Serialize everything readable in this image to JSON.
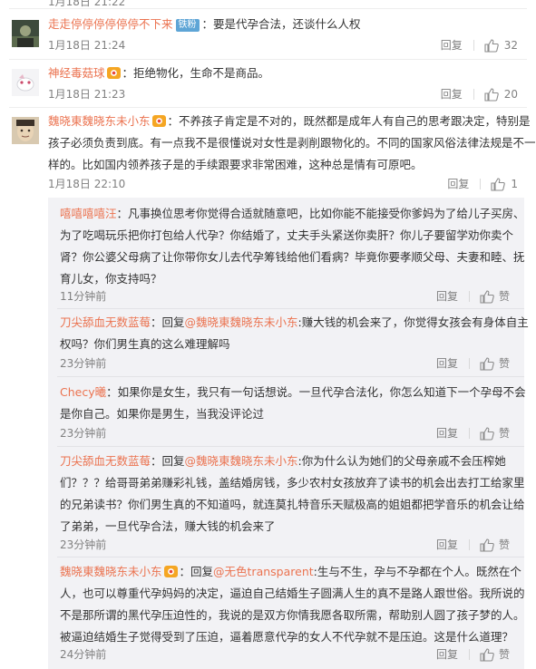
{
  "top_partial": {
    "time": "1月18日 21:22",
    "likes": ""
  },
  "comments": [
    {
      "id": "c1",
      "username": "走走停停停停停停不下来",
      "badge": "铁粉",
      "text": "：要是代孕合法，还谈什么人权",
      "time": "1月18日 21:24",
      "reply_label": "回复",
      "likes": "32"
    },
    {
      "id": "c2",
      "username": "神经毒菇球",
      "text": "：拒绝物化，生命不是商品。",
      "time": "1月18日 21:23",
      "reply_label": "回复",
      "likes": "20"
    },
    {
      "id": "c3",
      "username": "魏晓東魏晓东未小东",
      "lines": [
        "：不养孩子肯定是不对的，既然都是成年人有自己的思考跟决定，特别是",
        "孩子必须负责到底。有一点我不是很懂说对女性是剥削跟物化的。不同的国家风俗法律法规是不一",
        "样的。比如国内领养孩子是的手续跟要求非常困难，这种总是情有可原吧。"
      ],
      "time": "1月18日 22:10",
      "reply_label": "回复",
      "likes": "1"
    }
  ],
  "replies": [
    {
      "username": "嘻嘻嘻嘻汪",
      "lines": [
        "：凡事换位思考你觉得合适就随意吧，比如你能不能接受你爹妈为了给儿子买房、",
        "为了吃喝玩乐把你打包给人代孕？你结婚了，丈夫手头紧送你卖肝？你儿子要留学劝你卖个",
        "肾？你公婆父母病了让你带你女儿去代孕筹钱给他们看病？毕竟你要孝顺父母、夫妻和睦、抚",
        "育儿女，你支持吗？"
      ],
      "time": "11分钟前",
      "reply_label": "回复",
      "like_label": "赞"
    },
    {
      "username": "刀尖舔血无数蓝莓",
      "reply_prefix": "：回复",
      "mention": "@魏晓東魏晓东未小东",
      "lines": [
        ":赚大钱的机会来了，你觉得女孩会有身体自主",
        "权吗？你们男生真的这么难理解吗"
      ],
      "time": "23分钟前",
      "reply_label": "回复",
      "like_label": "赞"
    },
    {
      "username": "Checy曦",
      "lines": [
        "：如果你是女生，我只有一句话想说。一旦代孕合法化，你怎么知道下一个孕母不会",
        "是你自己。如果你是男生，当我没评论过"
      ],
      "time": "23分钟前",
      "reply_label": "回复",
      "like_label": "赞"
    },
    {
      "username": "刀尖舔血无数蓝莓",
      "reply_prefix": "：回复",
      "mention": "@魏晓東魏晓东未小东",
      "lines": [
        ":你为什么认为她们的父母亲戚不会压榨她",
        "们？？？给哥哥弟弟赚彩礼钱，盖结婚房钱，多少农村女孩放弃了读书的机会出去打工给家里",
        "的兄弟读书？你们男生真的不知道吗，就连莫扎特音乐天赋极高的姐姐都把学音乐的机会让给",
        "了弟弟，一旦代孕合法，赚大钱的机会来了"
      ],
      "time": "23分钟前",
      "reply_label": "回复",
      "like_label": "赞"
    },
    {
      "username": "魏晓東魏晓东未小东",
      "reply_prefix": "：回复",
      "mention": "@无色transparent",
      "lines": [
        ":生与不生，孕与不孕都在个人。既然在个",
        "人，也可以尊重代孕妈妈的决定，逼迫自己结婚生子圆满人生的真不是路人跟世俗。我所说的",
        "不是那所谓的黑代孕压迫性的，我说的是双方你情我愿各取所需，帮助别人圆了孩子梦的人。",
        "被逼迫结婚生子觉得受到了压迫，逼着愿意代孕的女人不代孕就不是压迫。这是什么道理？"
      ],
      "time": "24分钟前",
      "reply_label": "回复",
      "like_label": "赞"
    }
  ]
}
